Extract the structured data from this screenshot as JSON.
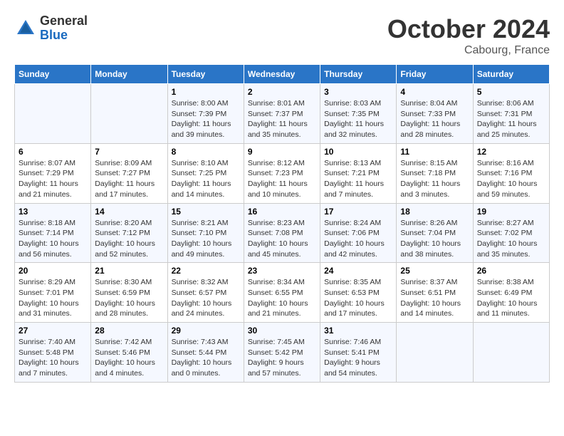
{
  "header": {
    "logo_line1": "General",
    "logo_line2": "Blue",
    "month": "October 2024",
    "location": "Cabourg, France"
  },
  "weekdays": [
    "Sunday",
    "Monday",
    "Tuesday",
    "Wednesday",
    "Thursday",
    "Friday",
    "Saturday"
  ],
  "rows": [
    [
      {
        "day": "",
        "info": ""
      },
      {
        "day": "",
        "info": ""
      },
      {
        "day": "1",
        "info": "Sunrise: 8:00 AM\nSunset: 7:39 PM\nDaylight: 11 hours and 39 minutes."
      },
      {
        "day": "2",
        "info": "Sunrise: 8:01 AM\nSunset: 7:37 PM\nDaylight: 11 hours and 35 minutes."
      },
      {
        "day": "3",
        "info": "Sunrise: 8:03 AM\nSunset: 7:35 PM\nDaylight: 11 hours and 32 minutes."
      },
      {
        "day": "4",
        "info": "Sunrise: 8:04 AM\nSunset: 7:33 PM\nDaylight: 11 hours and 28 minutes."
      },
      {
        "day": "5",
        "info": "Sunrise: 8:06 AM\nSunset: 7:31 PM\nDaylight: 11 hours and 25 minutes."
      }
    ],
    [
      {
        "day": "6",
        "info": "Sunrise: 8:07 AM\nSunset: 7:29 PM\nDaylight: 11 hours and 21 minutes."
      },
      {
        "day": "7",
        "info": "Sunrise: 8:09 AM\nSunset: 7:27 PM\nDaylight: 11 hours and 17 minutes."
      },
      {
        "day": "8",
        "info": "Sunrise: 8:10 AM\nSunset: 7:25 PM\nDaylight: 11 hours and 14 minutes."
      },
      {
        "day": "9",
        "info": "Sunrise: 8:12 AM\nSunset: 7:23 PM\nDaylight: 11 hours and 10 minutes."
      },
      {
        "day": "10",
        "info": "Sunrise: 8:13 AM\nSunset: 7:21 PM\nDaylight: 11 hours and 7 minutes."
      },
      {
        "day": "11",
        "info": "Sunrise: 8:15 AM\nSunset: 7:18 PM\nDaylight: 11 hours and 3 minutes."
      },
      {
        "day": "12",
        "info": "Sunrise: 8:16 AM\nSunset: 7:16 PM\nDaylight: 10 hours and 59 minutes."
      }
    ],
    [
      {
        "day": "13",
        "info": "Sunrise: 8:18 AM\nSunset: 7:14 PM\nDaylight: 10 hours and 56 minutes."
      },
      {
        "day": "14",
        "info": "Sunrise: 8:20 AM\nSunset: 7:12 PM\nDaylight: 10 hours and 52 minutes."
      },
      {
        "day": "15",
        "info": "Sunrise: 8:21 AM\nSunset: 7:10 PM\nDaylight: 10 hours and 49 minutes."
      },
      {
        "day": "16",
        "info": "Sunrise: 8:23 AM\nSunset: 7:08 PM\nDaylight: 10 hours and 45 minutes."
      },
      {
        "day": "17",
        "info": "Sunrise: 8:24 AM\nSunset: 7:06 PM\nDaylight: 10 hours and 42 minutes."
      },
      {
        "day": "18",
        "info": "Sunrise: 8:26 AM\nSunset: 7:04 PM\nDaylight: 10 hours and 38 minutes."
      },
      {
        "day": "19",
        "info": "Sunrise: 8:27 AM\nSunset: 7:02 PM\nDaylight: 10 hours and 35 minutes."
      }
    ],
    [
      {
        "day": "20",
        "info": "Sunrise: 8:29 AM\nSunset: 7:01 PM\nDaylight: 10 hours and 31 minutes."
      },
      {
        "day": "21",
        "info": "Sunrise: 8:30 AM\nSunset: 6:59 PM\nDaylight: 10 hours and 28 minutes."
      },
      {
        "day": "22",
        "info": "Sunrise: 8:32 AM\nSunset: 6:57 PM\nDaylight: 10 hours and 24 minutes."
      },
      {
        "day": "23",
        "info": "Sunrise: 8:34 AM\nSunset: 6:55 PM\nDaylight: 10 hours and 21 minutes."
      },
      {
        "day": "24",
        "info": "Sunrise: 8:35 AM\nSunset: 6:53 PM\nDaylight: 10 hours and 17 minutes."
      },
      {
        "day": "25",
        "info": "Sunrise: 8:37 AM\nSunset: 6:51 PM\nDaylight: 10 hours and 14 minutes."
      },
      {
        "day": "26",
        "info": "Sunrise: 8:38 AM\nSunset: 6:49 PM\nDaylight: 10 hours and 11 minutes."
      }
    ],
    [
      {
        "day": "27",
        "info": "Sunrise: 7:40 AM\nSunset: 5:48 PM\nDaylight: 10 hours and 7 minutes."
      },
      {
        "day": "28",
        "info": "Sunrise: 7:42 AM\nSunset: 5:46 PM\nDaylight: 10 hours and 4 minutes."
      },
      {
        "day": "29",
        "info": "Sunrise: 7:43 AM\nSunset: 5:44 PM\nDaylight: 10 hours and 0 minutes."
      },
      {
        "day": "30",
        "info": "Sunrise: 7:45 AM\nSunset: 5:42 PM\nDaylight: 9 hours and 57 minutes."
      },
      {
        "day": "31",
        "info": "Sunrise: 7:46 AM\nSunset: 5:41 PM\nDaylight: 9 hours and 54 minutes."
      },
      {
        "day": "",
        "info": ""
      },
      {
        "day": "",
        "info": ""
      }
    ]
  ]
}
